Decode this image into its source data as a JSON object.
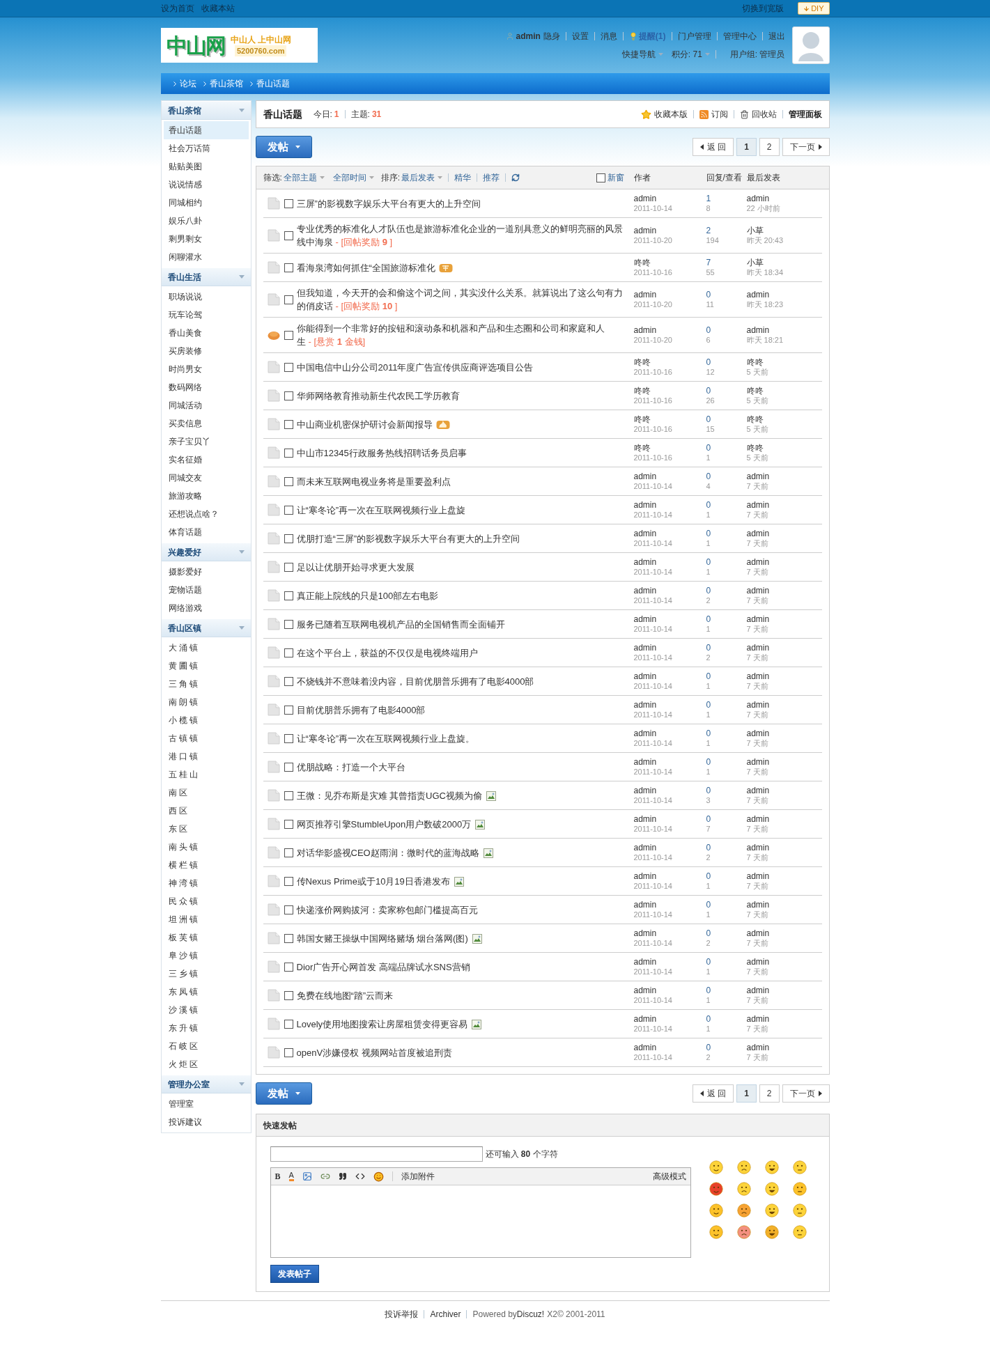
{
  "top_bar": {
    "links": [
      "设为首页",
      "收藏本站"
    ],
    "switch_width": "切换到宽版",
    "diy": "DIY"
  },
  "header": {
    "logo": {
      "name": "中山网",
      "slogan": "中山人 上中山网",
      "domain": "5200760.com"
    },
    "user_links": [
      {
        "text": "admin",
        "kind": "user"
      },
      {
        "text": "隐身",
        "kind": "link"
      },
      {
        "text": "设置",
        "kind": "link"
      },
      {
        "text": "消息",
        "kind": "link"
      },
      {
        "text": "提醒(1)",
        "kind": "notice"
      },
      {
        "text": "门户管理",
        "kind": "link"
      },
      {
        "text": "管理中心",
        "kind": "link"
      },
      {
        "text": "退出",
        "kind": "link"
      }
    ],
    "user_info": [
      {
        "text": "快捷导航",
        "dropdown": true
      },
      {
        "text": "积分: 71",
        "dropdown": true
      },
      {
        "text": "用户组: 管理员",
        "dropdown": false
      }
    ]
  },
  "breadcrumb": [
    "论坛",
    "香山茶馆",
    "香山话题"
  ],
  "sidebar": [
    {
      "title": "香山茶馆",
      "items": [
        {
          "label": "香山话题",
          "selected": true
        },
        {
          "label": "社会万话筒",
          "selected": false
        },
        {
          "label": "贴贴美图",
          "selected": false
        },
        {
          "label": "说说情感",
          "selected": false
        },
        {
          "label": "同城相约",
          "selected": false
        },
        {
          "label": "娱乐八卦",
          "selected": false
        },
        {
          "label": "剩男剩女",
          "selected": false
        },
        {
          "label": "闲聊灌水",
          "selected": false
        }
      ]
    },
    {
      "title": "香山生活",
      "items": [
        {
          "label": "职场说说",
          "selected": false
        },
        {
          "label": "玩车论驾",
          "selected": false
        },
        {
          "label": "香山美食",
          "selected": false
        },
        {
          "label": "买房装修",
          "selected": false
        },
        {
          "label": "时尚男女",
          "selected": false
        },
        {
          "label": "数码网络",
          "selected": false
        },
        {
          "label": "同城活动",
          "selected": false
        },
        {
          "label": "买卖信息",
          "selected": false
        },
        {
          "label": "亲子宝贝丫",
          "selected": false
        },
        {
          "label": "实名征婚",
          "selected": false
        },
        {
          "label": "同城交友",
          "selected": false
        },
        {
          "label": "旅游攻略",
          "selected": false
        },
        {
          "label": "还想说点啥？",
          "selected": false
        },
        {
          "label": "体育话题",
          "selected": false
        }
      ]
    },
    {
      "title": "兴趣爱好",
      "items": [
        {
          "label": "摄影爱好",
          "selected": false
        },
        {
          "label": "宠物话题",
          "selected": false
        },
        {
          "label": "网络游戏",
          "selected": false
        }
      ]
    },
    {
      "title": "香山区镇",
      "items": [
        {
          "label": "大 涌 镇",
          "selected": false
        },
        {
          "label": "黄 圃 镇",
          "selected": false
        },
        {
          "label": "三 角 镇",
          "selected": false
        },
        {
          "label": "南 朗 镇",
          "selected": false
        },
        {
          "label": "小 榄 镇",
          "selected": false
        },
        {
          "label": "古 镇 镇",
          "selected": false
        },
        {
          "label": "港 口 镇",
          "selected": false
        },
        {
          "label": "五 桂 山",
          "selected": false
        },
        {
          "label": "南 区",
          "selected": false
        },
        {
          "label": "西 区",
          "selected": false
        },
        {
          "label": "东 区",
          "selected": false
        },
        {
          "label": "南 头 镇",
          "selected": false
        },
        {
          "label": "横 栏 镇",
          "selected": false
        },
        {
          "label": "神 湾 镇",
          "selected": false
        },
        {
          "label": "民 众 镇",
          "selected": false
        },
        {
          "label": "坦 洲 镇",
          "selected": false
        },
        {
          "label": "板 芙 镇",
          "selected": false
        },
        {
          "label": "阜 沙 镇",
          "selected": false
        },
        {
          "label": "三 乡 镇",
          "selected": false
        },
        {
          "label": "东 凤 镇",
          "selected": false
        },
        {
          "label": "沙 溪 镇",
          "selected": false
        },
        {
          "label": "东 升 镇",
          "selected": false
        },
        {
          "label": "石 岐 区",
          "selected": false
        },
        {
          "label": "火 炬 区",
          "selected": false
        }
      ]
    },
    {
      "title": "管理办公室",
      "items": [
        {
          "label": "管理室",
          "selected": false
        },
        {
          "label": "投诉建议",
          "selected": false
        }
      ]
    }
  ],
  "forum": {
    "title": "香山话题",
    "stats": [
      {
        "label": "今日:",
        "value": "1"
      },
      {
        "label": "主题:",
        "value": "31"
      }
    ],
    "actions": [
      {
        "label": "收藏本版",
        "kind": "star"
      },
      {
        "label": "订阅",
        "kind": "rss"
      },
      {
        "label": "回收站",
        "kind": "trash"
      },
      {
        "label": "管理面板",
        "kind": "plain"
      }
    ]
  },
  "toolbar_top": {
    "post_button": "发帖",
    "pager": [
      {
        "label": "返 回",
        "kind": "prev",
        "selected": false
      },
      {
        "label": "1",
        "kind": "page",
        "selected": true
      },
      {
        "label": "2",
        "kind": "page",
        "selected": false
      },
      {
        "label": "下一页",
        "kind": "next",
        "selected": false
      }
    ]
  },
  "filter": {
    "label": "筛选:",
    "options": [
      "全部主题",
      "全部时间"
    ],
    "sort_label": "排序:",
    "sort": "最后发表",
    "links": [
      "精华",
      "推荐"
    ],
    "new_window": {
      "label": "新窗",
      "checked": false
    },
    "columns": [
      "作者",
      "回复/查看",
      "最后发表"
    ]
  },
  "threads": [
    {
      "kind": "normal",
      "checked": false,
      "title": "三屏”的影视数字娱乐大平台有更大的上升空间",
      "author": "admin",
      "date": "2011-10-14",
      "replies": "1",
      "views": "8",
      "last_user": "admin",
      "last_time": "22 小时前"
    },
    {
      "kind": "normal",
      "checked": false,
      "title": "专业优秀的标准化人才队伍也是旅游标准化企业的一道别具意义的鲜明亮丽的风景线中海泉",
      "reward": {
        "text": "- [回帖奖励 **9** ]"
      },
      "author": "admin",
      "date": "2011-10-20",
      "replies": "2",
      "views": "194",
      "last_user": "小草",
      "last_time": "昨天 20:43"
    },
    {
      "kind": "normal",
      "checked": false,
      "title": "看海泉湾如何抓住“全国旅游标准化",
      "badges": [
        {
          "kind": "recommend"
        }
      ],
      "author": "咚咚",
      "date": "2011-10-16",
      "replies": "7",
      "views": "55",
      "last_user": "小草",
      "last_time": "昨天 18:34"
    },
    {
      "kind": "normal",
      "checked": false,
      "title": "但我知道，今天开的会和偷这个词之间，其实没什么关系。就算说出了这么句有力的俏皮话",
      "reward": {
        "text": "- [回帖奖励 **10** ]"
      },
      "author": "admin",
      "date": "2011-10-20",
      "replies": "0",
      "views": "11",
      "last_user": "admin",
      "last_time": "昨天 18:23"
    },
    {
      "kind": "reward",
      "checked": false,
      "title": "你能得到一个非常好的按钮和滚动条和机器和产品和生态圈和公司和家庭和人生",
      "reward": {
        "text": "- [悬赏 **1** 金钱]"
      },
      "author": "admin",
      "date": "2011-10-20",
      "replies": "0",
      "views": "6",
      "last_user": "admin",
      "last_time": "昨天 18:21"
    },
    {
      "kind": "normal",
      "checked": false,
      "title": "中国电信中山分公司2011年度广告宣传供应商评选项目公告",
      "author": "咚咚",
      "date": "2011-10-16",
      "replies": "0",
      "views": "12",
      "last_user": "咚咚",
      "last_time": "5 天前"
    },
    {
      "kind": "normal",
      "checked": false,
      "title": "华师网络教育推动新生代农民工学历教育",
      "author": "咚咚",
      "date": "2011-10-16",
      "replies": "0",
      "views": "26",
      "last_user": "咚咚",
      "last_time": "5 天前"
    },
    {
      "kind": "normal",
      "checked": false,
      "title": "中山商业机密保护研讨会新闻报导",
      "badges": [
        {
          "kind": "hot"
        }
      ],
      "author": "咚咚",
      "date": "2011-10-16",
      "replies": "0",
      "views": "15",
      "last_user": "咚咚",
      "last_time": "5 天前"
    },
    {
      "kind": "normal",
      "checked": false,
      "title": "中山市12345行政服务热线招聘话务员启事",
      "author": "咚咚",
      "date": "2011-10-16",
      "replies": "0",
      "views": "1",
      "last_user": "咚咚",
      "last_time": "5 天前"
    },
    {
      "kind": "normal",
      "checked": false,
      "title": "而未来互联网电视业务将是重要盈利点",
      "author": "admin",
      "date": "2011-10-14",
      "replies": "0",
      "views": "4",
      "last_user": "admin",
      "last_time": "7 天前"
    },
    {
      "kind": "normal",
      "checked": false,
      "title": "让“寒冬论”再一次在互联网视频行业上盘旋",
      "author": "admin",
      "date": "2011-10-14",
      "replies": "0",
      "views": "1",
      "last_user": "admin",
      "last_time": "7 天前"
    },
    {
      "kind": "normal",
      "checked": false,
      "title": "优朋打造“三屏”的影视数字娱乐大平台有更大的上升空间",
      "author": "admin",
      "date": "2011-10-14",
      "replies": "0",
      "views": "1",
      "last_user": "admin",
      "last_time": "7 天前"
    },
    {
      "kind": "normal",
      "checked": false,
      "title": "足以让优朋开始寻求更大发展",
      "author": "admin",
      "date": "2011-10-14",
      "replies": "0",
      "views": "1",
      "last_user": "admin",
      "last_time": "7 天前"
    },
    {
      "kind": "normal",
      "checked": false,
      "title": "真正能上院线的只是100部左右电影",
      "author": "admin",
      "date": "2011-10-14",
      "replies": "0",
      "views": "2",
      "last_user": "admin",
      "last_time": "7 天前"
    },
    {
      "kind": "normal",
      "checked": false,
      "title": "服务已随着互联网电视机产品的全国销售而全面铺开",
      "author": "admin",
      "date": "2011-10-14",
      "replies": "0",
      "views": "1",
      "last_user": "admin",
      "last_time": "7 天前"
    },
    {
      "kind": "normal",
      "checked": false,
      "title": "在这个平台上，获益的不仅仅是电视终端用户",
      "author": "admin",
      "date": "2011-10-14",
      "replies": "0",
      "views": "2",
      "last_user": "admin",
      "last_time": "7 天前"
    },
    {
      "kind": "normal",
      "checked": false,
      "title": "不烧钱并不意味着没内容，目前优朋普乐拥有了电影4000部",
      "author": "admin",
      "date": "2011-10-14",
      "replies": "0",
      "views": "1",
      "last_user": "admin",
      "last_time": "7 天前"
    },
    {
      "kind": "normal",
      "checked": false,
      "title": "目前优朋普乐拥有了电影4000部",
      "author": "admin",
      "date": "2011-10-14",
      "replies": "0",
      "views": "1",
      "last_user": "admin",
      "last_time": "7 天前"
    },
    {
      "kind": "normal",
      "checked": false,
      "title": "让“寒冬论”再一次在互联网视频行业上盘旋。",
      "author": "admin",
      "date": "2011-10-14",
      "replies": "0",
      "views": "1",
      "last_user": "admin",
      "last_time": "7 天前"
    },
    {
      "kind": "normal",
      "checked": false,
      "title": "优朋战略：打造一个大平台",
      "author": "admin",
      "date": "2011-10-14",
      "replies": "0",
      "views": "1",
      "last_user": "admin",
      "last_time": "7 天前"
    },
    {
      "kind": "normal",
      "checked": false,
      "title": "王微：见乔布斯是灾难 其曾指责UGC视频为偷",
      "badges": [
        {
          "kind": "image"
        }
      ],
      "author": "admin",
      "date": "2011-10-14",
      "replies": "0",
      "views": "3",
      "last_user": "admin",
      "last_time": "7 天前"
    },
    {
      "kind": "normal",
      "checked": false,
      "title": "网页推荐引擎StumbleUpon用户数破2000万",
      "badges": [
        {
          "kind": "image"
        }
      ],
      "author": "admin",
      "date": "2011-10-14",
      "replies": "0",
      "views": "7",
      "last_user": "admin",
      "last_time": "7 天前"
    },
    {
      "kind": "normal",
      "checked": false,
      "title": "对话华影盛视CEO赵雨润：微时代的蓝海战略",
      "badges": [
        {
          "kind": "image"
        }
      ],
      "author": "admin",
      "date": "2011-10-14",
      "replies": "0",
      "views": "2",
      "last_user": "admin",
      "last_time": "7 天前"
    },
    {
      "kind": "normal",
      "checked": false,
      "title": "传Nexus Prime或于10月19日香港发布",
      "badges": [
        {
          "kind": "image"
        }
      ],
      "author": "admin",
      "date": "2011-10-14",
      "replies": "0",
      "views": "1",
      "last_user": "admin",
      "last_time": "7 天前"
    },
    {
      "kind": "normal",
      "checked": false,
      "title": "快递涨价网购拔河：卖家称包邮门槛提高百元",
      "author": "admin",
      "date": "2011-10-14",
      "replies": "0",
      "views": "1",
      "last_user": "admin",
      "last_time": "7 天前"
    },
    {
      "kind": "normal",
      "checked": false,
      "title": "韩国女赌王操纵中国网络赌场 烟台落网(图)",
      "badges": [
        {
          "kind": "image"
        }
      ],
      "author": "admin",
      "date": "2011-10-14",
      "replies": "0",
      "views": "2",
      "last_user": "admin",
      "last_time": "7 天前"
    },
    {
      "kind": "normal",
      "checked": false,
      "title": "Dior广告开心网首发 高端品牌试水SNS营销",
      "author": "admin",
      "date": "2011-10-14",
      "replies": "0",
      "views": "1",
      "last_user": "admin",
      "last_time": "7 天前"
    },
    {
      "kind": "normal",
      "checked": false,
      "title": "免费在线地图“踏”云而来",
      "author": "admin",
      "date": "2011-10-14",
      "replies": "0",
      "views": "1",
      "last_user": "admin",
      "last_time": "7 天前"
    },
    {
      "kind": "normal",
      "checked": false,
      "title": "Lovely使用地图搜索让房屋租赁变得更容易",
      "badges": [
        {
          "kind": "image"
        }
      ],
      "author": "admin",
      "date": "2011-10-14",
      "replies": "0",
      "views": "1",
      "last_user": "admin",
      "last_time": "7 天前"
    },
    {
      "kind": "normal",
      "checked": false,
      "title": "openV涉嫌侵权 视频网站首度被追刑责",
      "author": "admin",
      "date": "2011-10-14",
      "replies": "0",
      "views": "2",
      "last_user": "admin",
      "last_time": "7 天前"
    }
  ],
  "toolbar_bottom": {
    "post_button": "发帖",
    "pager": [
      {
        "label": "返 回",
        "kind": "prev",
        "selected": false
      },
      {
        "label": "1",
        "kind": "page",
        "selected": true
      },
      {
        "label": "2",
        "kind": "page",
        "selected": false
      },
      {
        "label": "下一页",
        "kind": "next",
        "selected": false
      }
    ]
  },
  "quick_post": {
    "title": "快速发帖",
    "counter": "还可输入 **80** 个字符",
    "toolbar": {
      "bold": "B",
      "text_color_button": "A",
      "attach": "添加附件",
      "advanced": "高级模式"
    },
    "submit": "发表帖子"
  },
  "footer": {
    "links": [
      "投诉举报",
      "Archiver"
    ],
    "powered": "Powered by",
    "brand": "Discuz!",
    "version": "X2",
    "copyright": "© 2001-2011"
  }
}
